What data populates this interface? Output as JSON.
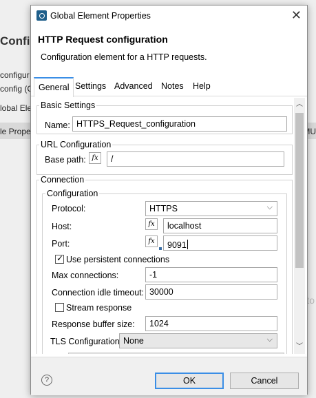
{
  "background": {
    "title": "Configur",
    "lines": [
      "configur",
      "config (C",
      "lobal Eler",
      "le Proper"
    ],
    "right_text": "MU",
    "faded_text": "to"
  },
  "dialog": {
    "title": "Global Element Properties",
    "header_title": "HTTP Request configuration",
    "header_desc": "Configuration element for a HTTP requests.",
    "tabs": [
      "General",
      "Settings",
      "Advanced",
      "Notes",
      "Help"
    ],
    "active_tab": "General"
  },
  "basic": {
    "group_label": "Basic Settings",
    "name_label": "Name:",
    "name_value": "HTTPS_Request_configuration"
  },
  "url": {
    "group_label": "URL Configuration",
    "base_path_label": "Base path:",
    "base_path_value": "/",
    "fx": "fx"
  },
  "connection": {
    "group_label": "Connection",
    "config_label": "Configuration",
    "protocol_label": "Protocol:",
    "protocol_value": "HTTPS",
    "host_label": "Host:",
    "host_value": "localhost",
    "port_label": "Port:",
    "port_value": "9091",
    "persistent_label": "Use persistent connections",
    "persistent_checked": true,
    "max_conn_label": "Max connections:",
    "max_conn_value": "-1",
    "idle_label": "Connection idle timeout:",
    "idle_value": "30000",
    "stream_label": "Stream response",
    "stream_checked": false,
    "buffer_label": "Response buffer size:",
    "buffer_value": "1024",
    "tls_label": "TLS Configuration",
    "tls_value": "None"
  },
  "footer": {
    "help": "?",
    "ok": "OK",
    "cancel": "Cancel"
  }
}
